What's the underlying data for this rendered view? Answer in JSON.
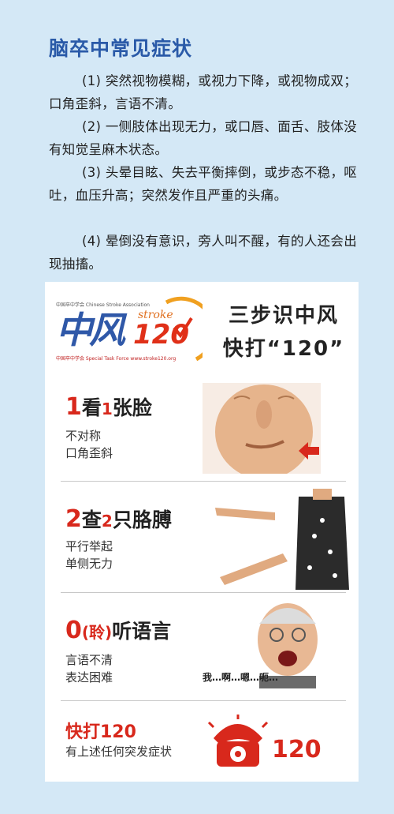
{
  "title": "脑卒中常见症状",
  "symptoms": [
    "(1) 突然视物模糊，或视力下降，或视物成双；口角歪斜，言语不清。",
    "(2) 一侧肢体出现无力，或口唇、面舌、肢体没有知觉呈麻木状态。",
    "(3) 头晕目眩、失去平衡摔倒，或步态不稳，呕吐，血压升高；突然发作且严重的头痛。",
    "(4) 晕倒没有意识，旁人叫不醒，有的人还会出现抽搐。"
  ],
  "poster": {
    "logo": {
      "org": "中国卒中学会 Chinese Stroke Association",
      "big": "中风",
      "stroke": "stroke",
      "num": "120",
      "slogan": "中国卒中学会 Special Task Force www.stroke120.org"
    },
    "headline_1": "三步识中风",
    "headline_2": "快打“120”",
    "steps": [
      {
        "n1": "1",
        "w1": "看",
        "n2": "1",
        "w2": "张脸",
        "desc1": "不对称",
        "desc2": "口角歪斜"
      },
      {
        "n1": "2",
        "w1": "查",
        "n2": "2",
        "w2": "只胳膊",
        "desc1": "平行举起",
        "desc2": "单侧无力"
      },
      {
        "n1": "0",
        "paren": "(聆)",
        "w2": "听语言",
        "desc1": "言语不清",
        "desc2": "表达困难",
        "speech": "我…啊…嗯…呃…"
      }
    ],
    "urgent_title": "快打120",
    "urgent_desc": "有上述任何突发症状",
    "emergency_number": "120"
  },
  "colors": {
    "background": "#d4e8f6",
    "title_blue": "#2a5aa8",
    "accent_red": "#d8281c"
  }
}
